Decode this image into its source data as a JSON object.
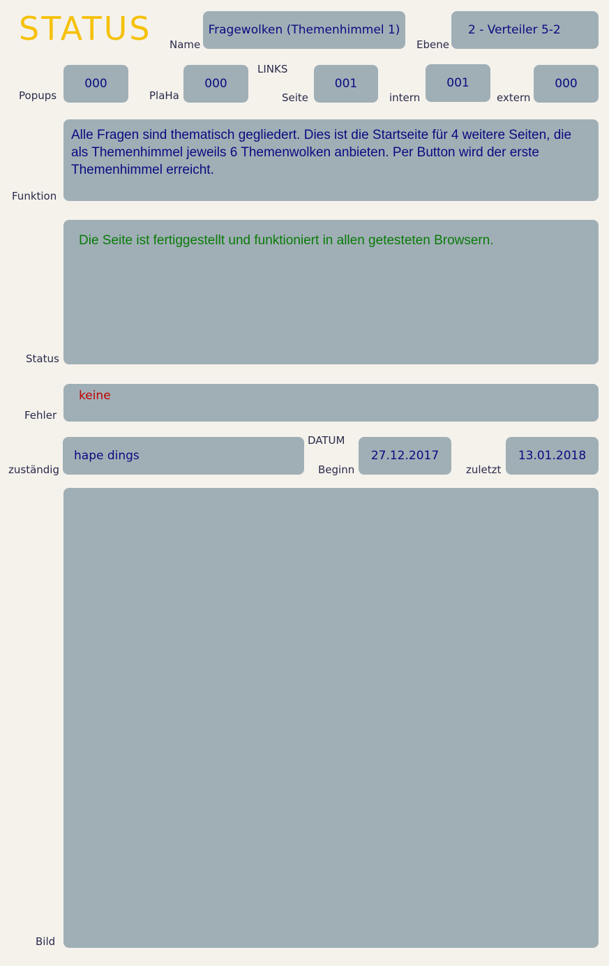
{
  "header": {
    "title": "STATUS",
    "title_color": "#f5c10a"
  },
  "fields": {
    "name": {
      "label": "Name",
      "value": "Fragewolken (Themenhimmel 1)"
    },
    "ebene": {
      "label": "Ebene",
      "value": "2 - Verteiler 5-2"
    },
    "popups": {
      "label": "Popups",
      "value": "000"
    },
    "plaha": {
      "label": "PlaHa",
      "value": "000"
    },
    "links": {
      "group_label": "LINKS",
      "seite": {
        "label": "Seite",
        "value": "001"
      },
      "intern": {
        "label": "intern",
        "value": "001"
      },
      "extern": {
        "label": "extern",
        "value": "000"
      }
    },
    "funktion": {
      "label": "Funktion",
      "value": "Alle Fragen sind thematisch gegliedert. Dies ist die Startseite für 4 weitere Seiten, die als Themenhimmel jeweils 6 Themenwolken anbieten. Per Button wird der erste Themenhimmel erreicht."
    },
    "status": {
      "label": "Status",
      "value": "Die Seite ist fertiggestellt und funktioniert in allen getesteten Browsern.",
      "color": "#0a7a0a"
    },
    "fehler": {
      "label": "Fehler",
      "value": "keine",
      "color": "#c00000"
    },
    "zustaendig": {
      "label": "zuständig",
      "value": "hape dings"
    },
    "datum": {
      "group_label": "DATUM",
      "beginn": {
        "label": "Beginn",
        "value": "27.12.2017"
      },
      "zuletzt": {
        "label": "zuletzt",
        "value": "13.01.2018"
      }
    },
    "bild": {
      "label": "Bild"
    }
  },
  "colors": {
    "background": "#f5f2ec",
    "box": "#a0afb6",
    "value_text": "#0a0a80",
    "label_text": "#2a2a4a"
  }
}
